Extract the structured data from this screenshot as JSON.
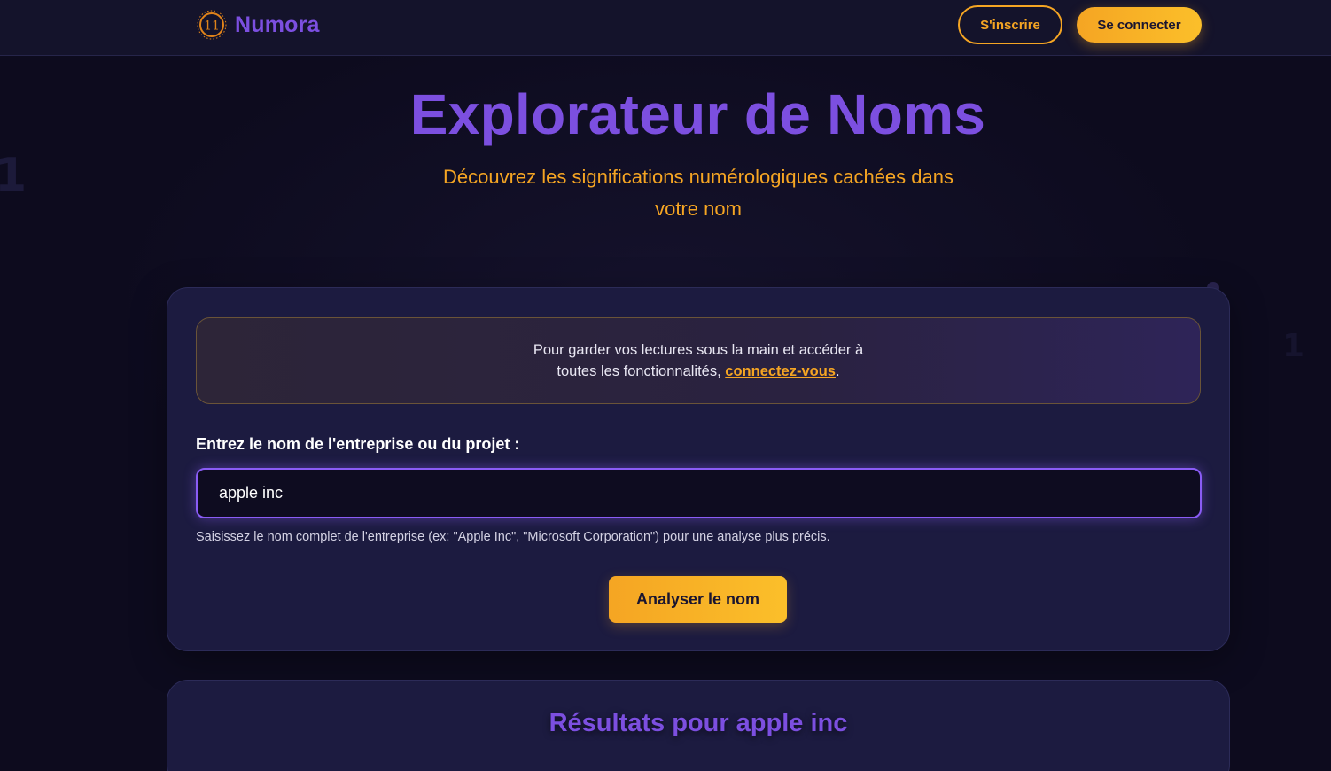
{
  "header": {
    "brand_logo_text": "11",
    "brand_name": "Numora",
    "signup_label": "S'inscrire",
    "login_label": "Se connecter"
  },
  "hero": {
    "title": "Explorateur de Noms",
    "subtitle": "Découvrez les significations numérologiques cachées dans votre nom"
  },
  "notice": {
    "text_before": "Pour garder vos lectures sous la main et accéder à toutes les fonctionnalités, ",
    "link_label": "connectez-vous",
    "text_after": "."
  },
  "form": {
    "label": "Entrez le nom de l'entreprise ou du projet :",
    "input_value": "apple inc",
    "hint": "Saisissez le nom complet de l'entreprise (ex: \"Apple Inc\", \"Microsoft Corporation\") pour une analyse plus précis.",
    "submit_label": "Analyser le nom"
  },
  "results": {
    "title": "Résultats pour apple inc"
  },
  "colors": {
    "accent_purple": "#7c4fe0",
    "accent_orange": "#f5a523",
    "background": "#0d0b1e",
    "card": "#1c1b40"
  }
}
